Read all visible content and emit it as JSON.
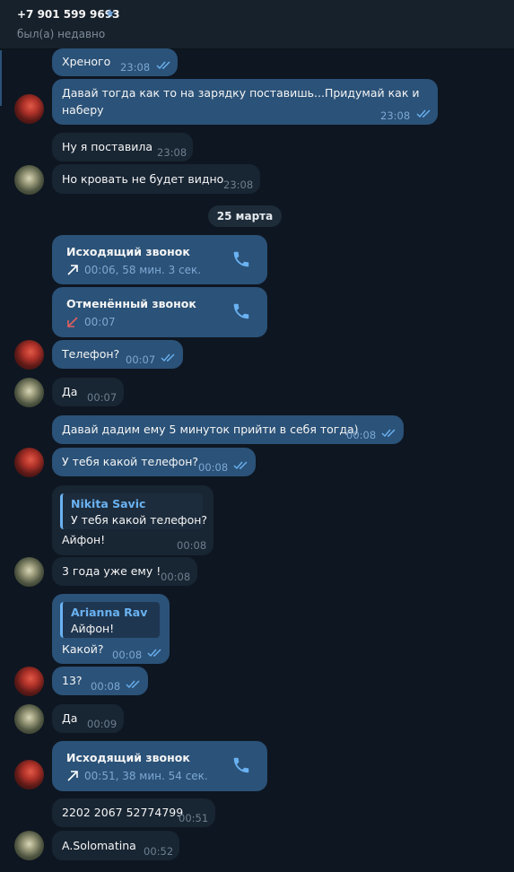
{
  "header": {
    "title": "+7 901 599 9693",
    "status": "был(а) недавно"
  },
  "date_separator": "25 марта",
  "messages": [
    {
      "text": "Хреного",
      "time": "23:08"
    },
    {
      "text": "Давай тогда как то на зарядку поставишь...Придумай как и",
      "text2": "наберу",
      "time": "23:08"
    },
    {
      "text": "Ну я поставила",
      "time": "23:08"
    },
    {
      "text": "Но кровать не будет видно",
      "time": "23:08"
    },
    {
      "call_title": "Исходящий звонок",
      "call_info": "00:06, 58 мин. 3 сек."
    },
    {
      "call_title": "Отменённый звонок",
      "call_info": "00:07"
    },
    {
      "text": "Телефон?",
      "time": "00:07"
    },
    {
      "text": "Да",
      "time": "00:07"
    },
    {
      "text": "Давай дадим ему 5 минуток прийти в себя тогда)",
      "time": "00:08"
    },
    {
      "text": "У тебя какой телефон?",
      "time": "00:08"
    },
    {
      "reply_name": "Nikita Savic",
      "reply_text": "У тебя какой телефон?",
      "text": "Айфон!",
      "time": "00:08"
    },
    {
      "text": "3 года уже ему !",
      "time": "00:08"
    },
    {
      "reply_name": "Arianna Rav",
      "reply_text": "Айфон!",
      "text": "Какой?",
      "time": "00:08"
    },
    {
      "text": "13?",
      "time": "00:08"
    },
    {
      "text": "Да",
      "time": "00:09"
    },
    {
      "call_title": "Исходящий звонок",
      "call_info": "00:51, 38 мин. 54 сек."
    },
    {
      "text": "2202 2067 52774799",
      "time": "00:51"
    },
    {
      "text": "A.Solomatina",
      "time": "00:52"
    }
  ],
  "colors": {
    "background": "#0e1621",
    "outgoing": "#2b5278",
    "incoming": "#182533",
    "accent": "#6ab2f2",
    "missed": "#e06060"
  }
}
